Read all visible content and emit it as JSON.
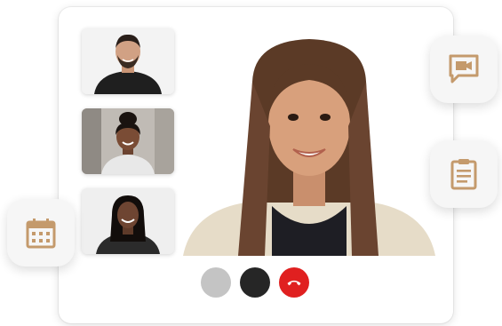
{
  "colors": {
    "accent": "#c49a6c",
    "end_call": "#e02020",
    "mic_control": "#c4c4c4",
    "camera_control": "#262626"
  },
  "participants": [
    {
      "icon": "person-avatar"
    },
    {
      "icon": "person-avatar"
    },
    {
      "icon": "person-avatar"
    }
  ],
  "main_speaker": {
    "icon": "person-avatar"
  },
  "controls": [
    {
      "icon": "mic-icon"
    },
    {
      "icon": "camera-icon"
    },
    {
      "icon": "hang-up-icon"
    }
  ],
  "side_actions": [
    {
      "icon": "video-chat-icon"
    },
    {
      "icon": "clipboard-icon"
    },
    {
      "icon": "calendar-icon"
    }
  ]
}
